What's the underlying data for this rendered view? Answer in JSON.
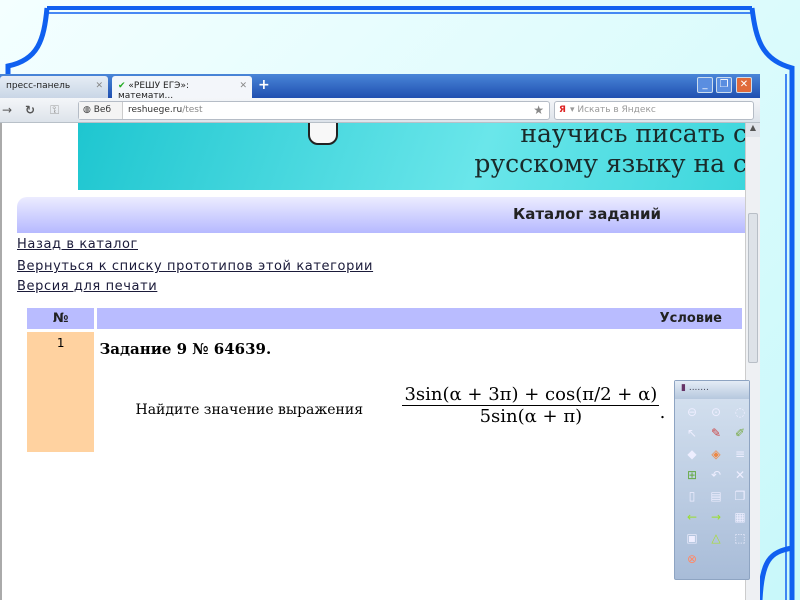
{
  "browser": {
    "tabs": [
      {
        "label": "пресс-панель",
        "close": "✕"
      },
      {
        "label": "«РЕШУ ЕГЭ»: математи...",
        "close": "✕"
      }
    ],
    "new_tab": "+",
    "web_label": "Веб",
    "url_host": "reshuege.ru",
    "url_path": "/test",
    "search_placeholder": "Искать в Яндекс",
    "search_engine_icon": "Я"
  },
  "banner": {
    "line1": "научись писать с",
    "line2": "русскому языку на с"
  },
  "catalog_title": "Каталог заданий",
  "links": [
    "Назад в каталог",
    "Вернуться к списку прототипов этой категории",
    "Версия для печати"
  ],
  "table": {
    "headers": [
      "№",
      "Условие"
    ],
    "rows": [
      {
        "num": "1",
        "task": "Задание 9 № 64639.",
        "question": "Найдите значение выражения",
        "numerator": "3sin(α + 3π) + cos(π/2 + α)",
        "denominator": "5sin(α + π)",
        "end": "."
      }
    ]
  },
  "toolbox": {
    "title": "......."
  }
}
